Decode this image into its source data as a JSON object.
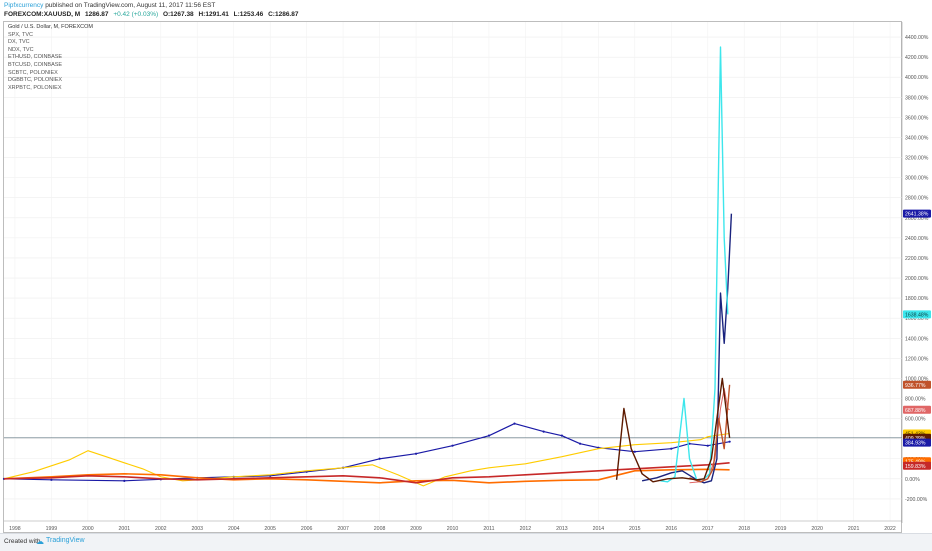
{
  "header": {
    "user": "Pipfxcurrency",
    "published_text": "published on TradingView.com, August 11, 2017 11:56 EST",
    "symbol": "FOREXCOM:XAUUSD, M",
    "price": "1286.87",
    "change": "+0.42 (+0.03%)",
    "open": "O:1267.38",
    "high": "H:1291.41",
    "low": "L:1253.46",
    "close": "C:1286.87"
  },
  "legend": {
    "main": "Gold / U.S. Dollar, M, FOREXCOM",
    "items": [
      "SPX, TVC",
      "DX, TVC",
      "NDX, TVC",
      "ETHUSD, COINBASE",
      "BTCUSD, COINBASE",
      "SCBTC, POLONIEX",
      "DGBBTC, POLONIEX",
      "XRPBTC, POLONIEX"
    ]
  },
  "footer": {
    "created": "Created with",
    "brand": "TradingView"
  },
  "chart_data": {
    "type": "line",
    "x_ticks": [
      "1998",
      "1999",
      "2000",
      "2001",
      "2002",
      "2003",
      "2004",
      "2005",
      "2006",
      "2007",
      "2008",
      "2009",
      "2010",
      "2011",
      "2012",
      "2013",
      "2014",
      "2015",
      "2016",
      "2017",
      "2018",
      "2019",
      "2020",
      "2021",
      "2022"
    ],
    "y_ticks": [
      -200,
      0,
      200,
      400,
      600,
      800,
      1000,
      1200,
      1400,
      1600,
      1800,
      2000,
      2200,
      2400,
      2600,
      2800,
      3000,
      3200,
      3400,
      3600,
      3800,
      4000,
      4200,
      4400
    ],
    "y_tick_suffix": ".00%",
    "xlim": [
      1997.7,
      2022.3
    ],
    "ylim": [
      -420,
      4550
    ],
    "grid": true,
    "series": [
      {
        "name": "Gold / U.S. Dollar",
        "color": "#1a1aa6",
        "width": 1.2,
        "dotted": true,
        "points": [
          [
            1997.7,
            0
          ],
          [
            1999,
            -10
          ],
          [
            2001,
            -20
          ],
          [
            2002,
            -5
          ],
          [
            2003,
            10
          ],
          [
            2004,
            20
          ],
          [
            2005,
            30
          ],
          [
            2006,
            70
          ],
          [
            2007,
            110
          ],
          [
            2008,
            200
          ],
          [
            2009,
            250
          ],
          [
            2010,
            330
          ],
          [
            2011,
            430
          ],
          [
            2011.7,
            550
          ],
          [
            2012.5,
            470
          ],
          [
            2013,
            430
          ],
          [
            2013.5,
            350
          ],
          [
            2014,
            310
          ],
          [
            2015,
            270
          ],
          [
            2016,
            300
          ],
          [
            2016.5,
            350
          ],
          [
            2017,
            330
          ],
          [
            2017.6,
            370
          ]
        ]
      },
      {
        "name": "SPX, TVC",
        "color": "#ffcc00",
        "width": 1.1,
        "points": [
          [
            1997.7,
            0
          ],
          [
            1998.5,
            70
          ],
          [
            1999.5,
            190
          ],
          [
            2000,
            280
          ],
          [
            2000.5,
            220
          ],
          [
            2001,
            160
          ],
          [
            2001.5,
            100
          ],
          [
            2002,
            20
          ],
          [
            2002.6,
            -20
          ],
          [
            2003,
            -10
          ],
          [
            2004,
            20
          ],
          [
            2005,
            40
          ],
          [
            2006,
            80
          ],
          [
            2007,
            110
          ],
          [
            2007.8,
            140
          ],
          [
            2008.5,
            40
          ],
          [
            2009.2,
            -70
          ],
          [
            2009.8,
            20
          ],
          [
            2010.5,
            80
          ],
          [
            2011,
            110
          ],
          [
            2012,
            150
          ],
          [
            2013,
            220
          ],
          [
            2014,
            300
          ],
          [
            2015,
            340
          ],
          [
            2016,
            360
          ],
          [
            2016.8,
            390
          ],
          [
            2017,
            420
          ],
          [
            2017.6,
            451
          ]
        ]
      },
      {
        "name": "DX, TVC",
        "color": "#ff6d00",
        "width": 1.6,
        "points": [
          [
            1997.7,
            0
          ],
          [
            1999,
            20
          ],
          [
            2000,
            40
          ],
          [
            2001,
            50
          ],
          [
            2002,
            40
          ],
          [
            2003,
            10
          ],
          [
            2004,
            -10
          ],
          [
            2005,
            0
          ],
          [
            2006,
            -10
          ],
          [
            2007,
            -25
          ],
          [
            2008,
            -40
          ],
          [
            2009,
            -20
          ],
          [
            2010,
            -15
          ],
          [
            2011,
            -40
          ],
          [
            2012,
            -25
          ],
          [
            2013,
            -15
          ],
          [
            2014,
            -10
          ],
          [
            2015,
            80
          ],
          [
            2016,
            90
          ],
          [
            2017,
            95
          ],
          [
            2017.6,
            90
          ]
        ]
      },
      {
        "name": "NDX, TVC",
        "color": "#c62828",
        "width": 1.6,
        "points": [
          [
            1997.7,
            0
          ],
          [
            1999,
            10
          ],
          [
            2000,
            30
          ],
          [
            2001,
            20
          ],
          [
            2002,
            0
          ],
          [
            2003,
            -10
          ],
          [
            2004,
            0
          ],
          [
            2005,
            10
          ],
          [
            2006,
            20
          ],
          [
            2007,
            30
          ],
          [
            2008,
            10
          ],
          [
            2009,
            -40
          ],
          [
            2010,
            10
          ],
          [
            2011,
            20
          ],
          [
            2012,
            40
          ],
          [
            2013,
            60
          ],
          [
            2014,
            80
          ],
          [
            2015,
            100
          ],
          [
            2016,
            120
          ],
          [
            2017,
            140
          ],
          [
            2017.6,
            160
          ]
        ]
      },
      {
        "name": "ETHUSD, COINBASE",
        "color": "#e06666",
        "width": 1.0,
        "points": [
          [
            2016.5,
            -40
          ],
          [
            2016.8,
            -30
          ],
          [
            2017.0,
            0
          ],
          [
            2017.2,
            200
          ],
          [
            2017.35,
            700
          ],
          [
            2017.45,
            900
          ],
          [
            2017.55,
            700
          ],
          [
            2017.6,
            687
          ]
        ]
      },
      {
        "name": "BTCUSD, COINBASE",
        "color": "#1a237e",
        "width": 1.4,
        "points": [
          [
            2015.2,
            -20
          ],
          [
            2015.6,
            10
          ],
          [
            2016.0,
            60
          ],
          [
            2016.3,
            80
          ],
          [
            2016.7,
            -10
          ],
          [
            2016.9,
            -40
          ],
          [
            2017.1,
            -20
          ],
          [
            2017.25,
            200
          ],
          [
            2017.35,
            1850
          ],
          [
            2017.45,
            1350
          ],
          [
            2017.55,
            1900
          ],
          [
            2017.65,
            2641
          ]
        ]
      },
      {
        "name": "SCBTC, POLONIEX",
        "color": "#3de6ec",
        "width": 1.4,
        "points": [
          [
            2015.7,
            -20
          ],
          [
            2015.9,
            -30
          ],
          [
            2016.1,
            20
          ],
          [
            2016.35,
            800
          ],
          [
            2016.5,
            200
          ],
          [
            2016.7,
            -10
          ],
          [
            2016.9,
            0
          ],
          [
            2017.05,
            50
          ],
          [
            2017.2,
            900
          ],
          [
            2017.35,
            4300
          ],
          [
            2017.45,
            2400
          ],
          [
            2017.55,
            1638
          ]
        ]
      },
      {
        "name": "DGBBTC, POLONIEX",
        "color": "#c0522a",
        "width": 1.4,
        "points": [
          [
            2016.5,
            10
          ],
          [
            2016.8,
            -30
          ],
          [
            2017.0,
            0
          ],
          [
            2017.15,
            100
          ],
          [
            2017.3,
            600
          ],
          [
            2017.45,
            300
          ],
          [
            2017.6,
            937
          ]
        ]
      },
      {
        "name": "XRPBTC, POLONIEX",
        "color": "#5d1a00",
        "width": 1.4,
        "points": [
          [
            2014.5,
            -10
          ],
          [
            2014.7,
            700
          ],
          [
            2014.9,
            300
          ],
          [
            2015.2,
            50
          ],
          [
            2015.5,
            -30
          ],
          [
            2015.9,
            0
          ],
          [
            2016.3,
            10
          ],
          [
            2016.7,
            -10
          ],
          [
            2016.9,
            0
          ],
          [
            2017.1,
            200
          ],
          [
            2017.25,
            600
          ],
          [
            2017.4,
            1000
          ],
          [
            2017.6,
            409
          ]
        ]
      }
    ],
    "price_line": {
      "value": 409,
      "color": "#546e7a"
    },
    "end_labels": [
      {
        "text": "2641.38%",
        "value": 2641,
        "bg": "#1a1aa6",
        "fg": "#ffffff"
      },
      {
        "text": "1638.48%",
        "value": 1638,
        "bg": "#3de6ec",
        "fg": "#0b3d40"
      },
      {
        "text": "936.77%",
        "value": 937,
        "bg": "#c0522a",
        "fg": "#ffffff"
      },
      {
        "text": "687.88%",
        "value": 688,
        "bg": "#e06666",
        "fg": "#ffffff"
      },
      {
        "text": "451.43%",
        "value": 451,
        "bg": "#ffcc00",
        "fg": "#3a3000"
      },
      {
        "text": "409.39%",
        "value": 409,
        "bg": "#5d1a00",
        "fg": "#ffffff"
      },
      {
        "text": "384.93%",
        "value": 360,
        "bg": "#1a1aa6",
        "fg": "#ffffff"
      },
      {
        "text": "175.49%",
        "value": 175,
        "bg": "#ff6d00",
        "fg": "#ffffff"
      },
      {
        "text": "159.83%",
        "value": 130,
        "bg": "#c62828",
        "fg": "#ffffff"
      }
    ]
  }
}
